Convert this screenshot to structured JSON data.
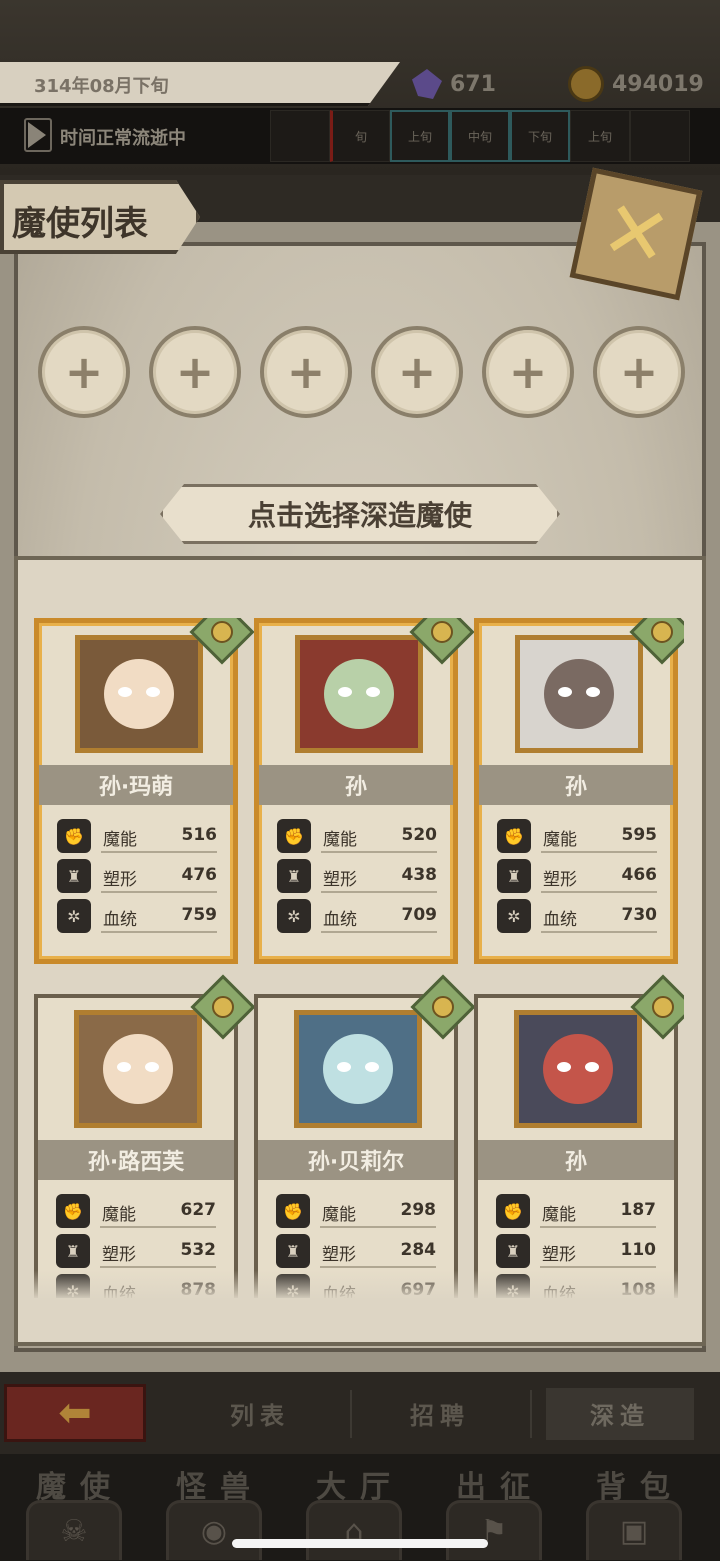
{
  "status": {
    "date": "314年08月下旬",
    "gems": "671",
    "gold": "494019",
    "time_flow": "时间正常流逝中",
    "period_ticks": [
      "",
      "旬",
      "上旬",
      "中旬",
      "下旬",
      "上旬",
      ""
    ]
  },
  "panel": {
    "title": "魔使列表",
    "close_icon": "close-x-icon",
    "slot_symbol": "+",
    "select_prompt": "点击选择深造魔使"
  },
  "stat_labels": {
    "magic": "魔能",
    "shape": "塑形",
    "blood": "血统"
  },
  "cards": [
    {
      "name": "孙·玛萌",
      "magic": "516",
      "shape": "476",
      "blood": "759",
      "selected": true
    },
    {
      "name": "孙",
      "magic": "520",
      "shape": "438",
      "blood": "709",
      "selected": true
    },
    {
      "name": "孙",
      "magic": "595",
      "shape": "466",
      "blood": "730",
      "selected": true
    },
    {
      "name": "孙·路西芙",
      "magic": "627",
      "shape": "532",
      "blood": "878",
      "selected": false
    },
    {
      "name": "孙·贝莉尔",
      "magic": "298",
      "shape": "284",
      "blood": "697",
      "selected": false
    },
    {
      "name": "孙",
      "magic": "187",
      "shape": "110",
      "blood": "108",
      "selected": false
    }
  ],
  "subnav": {
    "back_icon": "arrow-left-icon",
    "tabs": [
      "列表",
      "招聘",
      "深造"
    ],
    "active": "深造"
  },
  "mainnav": [
    "魔使",
    "怪兽",
    "大厅",
    "出征",
    "背包"
  ]
}
